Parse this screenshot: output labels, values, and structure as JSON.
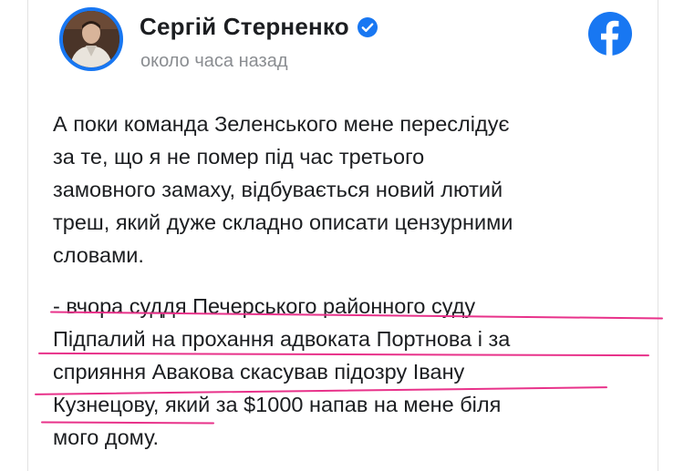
{
  "post": {
    "author": "Сергій Стерненко",
    "timestamp": "около часа назад",
    "paragraphs": [
      [
        "А поки команда Зеленського мене переслідує",
        "за те, що я не помер під час третього",
        "замовного замаху, відбувається новий лютий",
        "треш, який дуже складно описати цензурними",
        "словами."
      ],
      [
        "- вчора суддя Печерського районного суду",
        "Підпалий на прохання адвоката Портнова і за",
        "сприяння Авакова скасував підозру Івану",
        "Кузнецову, який за $1000 напав на мене біля",
        "мого дому."
      ]
    ]
  },
  "icons": {
    "verified": "verified-badge-icon",
    "platform": "facebook-logo-icon"
  },
  "colors": {
    "facebook_blue": "#1877f2",
    "highlight_underline": "#e8328a",
    "text": "#1c1e21",
    "muted": "#8a8d91"
  }
}
